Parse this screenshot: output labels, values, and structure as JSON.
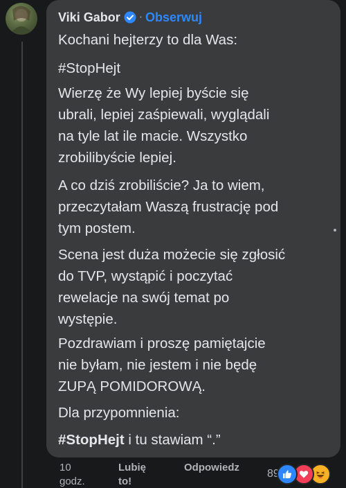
{
  "comment": {
    "author": "Viki Gabor",
    "separator": "·",
    "follow_label": "Obserwuj",
    "paragraphs": [
      {
        "lines": [
          "Kochani hejterzy to dla Was:"
        ]
      },
      {
        "lines": [
          "#StopHejt"
        ]
      },
      {
        "lines": [
          "Wierzę że Wy lepiej byście się",
          "ubrali, lepiej zaśpiewali, wyglądali",
          "na tyle lat ile macie. Wszystko",
          "zrobilibyście lepiej."
        ]
      },
      {
        "lines": [
          "A co dziś zrobiliście? Ja to wiem,",
          "przeczytałam Waszą frustrację pod",
          "tym postem."
        ]
      },
      {
        "lines": [
          "Scena jest duża możecie się zgłosić",
          "do TVP, wystąpić i poczytać",
          "rewelacje na swój temat po",
          "występie."
        ]
      },
      {
        "lines": [
          "Pozdrawiam i proszę pamiętajcie",
          "nie byłam, nie jestem i nie będę",
          "ZUPĄ POMIDOROWĄ."
        ]
      },
      {
        "lines": [
          "Dla przypomnienia:"
        ]
      },
      {
        "bold_part": "#StopHejt",
        "rest": " i tu stawiam “.”"
      }
    ]
  },
  "footer": {
    "time_lines": [
      "10",
      "godz."
    ],
    "like_lines": [
      "Lubię",
      "to!"
    ],
    "reply_label": "Odpowiedz",
    "reaction_count": "89",
    "reactions": [
      "like-icon",
      "love-icon",
      "haha-icon"
    ]
  },
  "colors": {
    "background": "#18191a",
    "bubble": "#3a3b3c",
    "text": "#e4e6eb",
    "muted": "#b0b3b8",
    "link": "#2d88ff",
    "verified": "#2d88ff",
    "like": "#2d88ff",
    "love": "#f33e58",
    "haha": "#f7b125"
  }
}
